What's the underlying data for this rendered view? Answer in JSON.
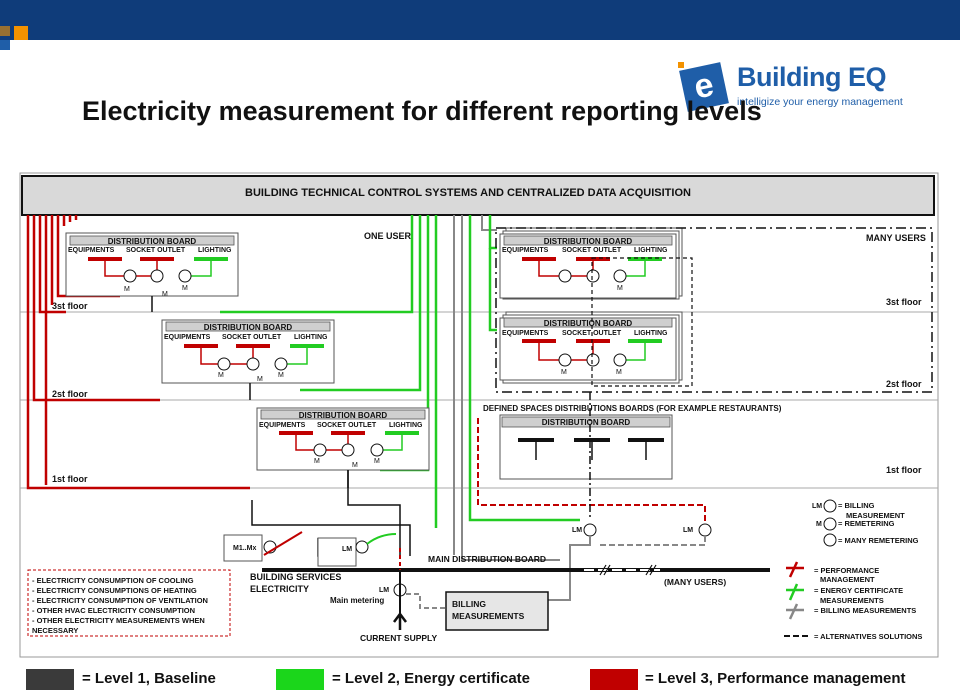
{
  "slide": {
    "title": "Electricity measurement for different reporting levels"
  },
  "logo": {
    "letter": "e",
    "name": "Building EQ",
    "tagline": "intelligize your energy management"
  },
  "diagram": {
    "header": "BUILDING TECHNICAL CONTROL SYSTEMS AND CENTRALIZED DATA ACQUISITION",
    "one_user": "ONE USER",
    "many_users": "MANY USERS",
    "many_users_bottom": "(MANY USERS)",
    "floors": {
      "third": "3st floor",
      "second": "2st floor",
      "first": "1st floor"
    },
    "board": {
      "title": "DISTRIBUTION BOARD",
      "equipments": "EQUIPMENTS",
      "socket_outlet": "SOCKET OUTLET",
      "lighting": "LIGHTING",
      "meter": "M"
    },
    "defined_spaces": "DEFINED SPACES DISTRIBUTIONS BOARDS (FOR EXAMPLE RESTAURANTS)",
    "main_board": "MAIN DISTRIBUTION BOARD",
    "building_services": "BUILDING SERVICES",
    "electricity": "ELECTRICITY",
    "main_metering": "Main metering",
    "billing_measurements": [
      "BILLING",
      "MEASUREMENTS"
    ],
    "current_supply": "CURRENT SUPPLY",
    "m1mx": "M1..Mx",
    "lm": "LM",
    "consumption_list": [
      "- ELECTRICITY CONSUMPTION OF COOLING",
      "- ELECTRICITY CONSUMPTIONS OF HEATING",
      "- ELECTRICITY CONSUMPTION OF VENTILATION",
      "- OTHER HVAC ELECTRICITY CONSUMPTION",
      "- OTHER ELECTRICITY MEASUREMENTS WHEN",
      "  NECESSARY"
    ],
    "symbol_legend": {
      "lm_label": "LM",
      "billing": [
        "= BILLING",
        "MEASUREMENT"
      ],
      "m_label": "M",
      "remetering": "= REMETERING",
      "many_remetering": "= MANY REMETERING",
      "performance": [
        "= PERFORMANCE",
        "MANAGEMENT"
      ],
      "energy_certificate": [
        "= ENERGY CERTIFICATE",
        "MEASUREMENTS"
      ],
      "billing_measurements": "= BILLING MEASUREMENTS",
      "alternatives": "= ALTERNATIVES SOLUTIONS"
    }
  },
  "levels": [
    {
      "label": "= Level 1, Baseline",
      "color": "#3a3a3a"
    },
    {
      "label": "= Level 2, Energy certificate",
      "color": "#1bd61b"
    },
    {
      "label": "= Level 3, Performance management",
      "color": "#c00000"
    }
  ],
  "colors": {
    "red": "#c00000",
    "green": "#22cc22",
    "black": "#111111",
    "gray": "#8a8a8a",
    "header_bg": "#d9d9d9"
  }
}
